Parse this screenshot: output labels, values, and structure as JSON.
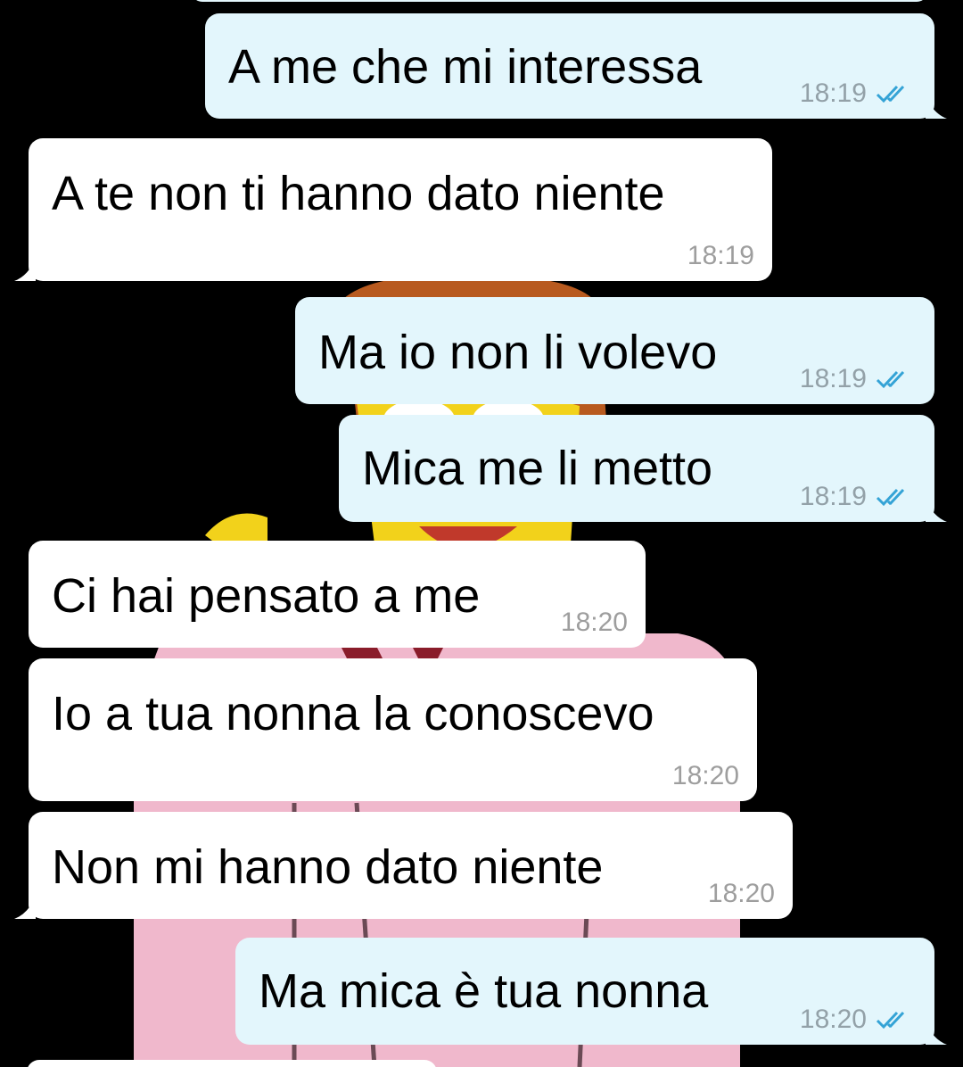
{
  "conversation": {
    "messages": [
      {
        "direction": "outgoing",
        "text": "A me che mi interessa",
        "time": "18:19",
        "status_icon": "double-check-read-icon"
      },
      {
        "direction": "incoming",
        "text": "A te non ti hanno dato niente",
        "time": "18:19"
      },
      {
        "direction": "outgoing",
        "text": "Ma io non li volevo",
        "time": "18:19",
        "status_icon": "double-check-read-icon"
      },
      {
        "direction": "outgoing",
        "text": "Mica me li metto",
        "time": "18:19",
        "status_icon": "double-check-read-icon"
      },
      {
        "direction": "incoming",
        "text": "Ci hai pensato a me",
        "time": "18:20"
      },
      {
        "direction": "incoming",
        "text": "Io a tua nonna la conoscevo",
        "time": "18:20"
      },
      {
        "direction": "incoming",
        "text": "Non mi hanno dato niente",
        "time": "18:20"
      },
      {
        "direction": "outgoing",
        "text": "Ma mica è tua nonna",
        "time": "18:20",
        "status_icon": "double-check-read-icon"
      }
    ]
  },
  "colors": {
    "background": "#000000",
    "outgoing_bubble": "#e3f6fc",
    "incoming_bubble": "#ffffff",
    "read_ticks": "#34a3d6",
    "timestamp": "#93a1a8"
  }
}
